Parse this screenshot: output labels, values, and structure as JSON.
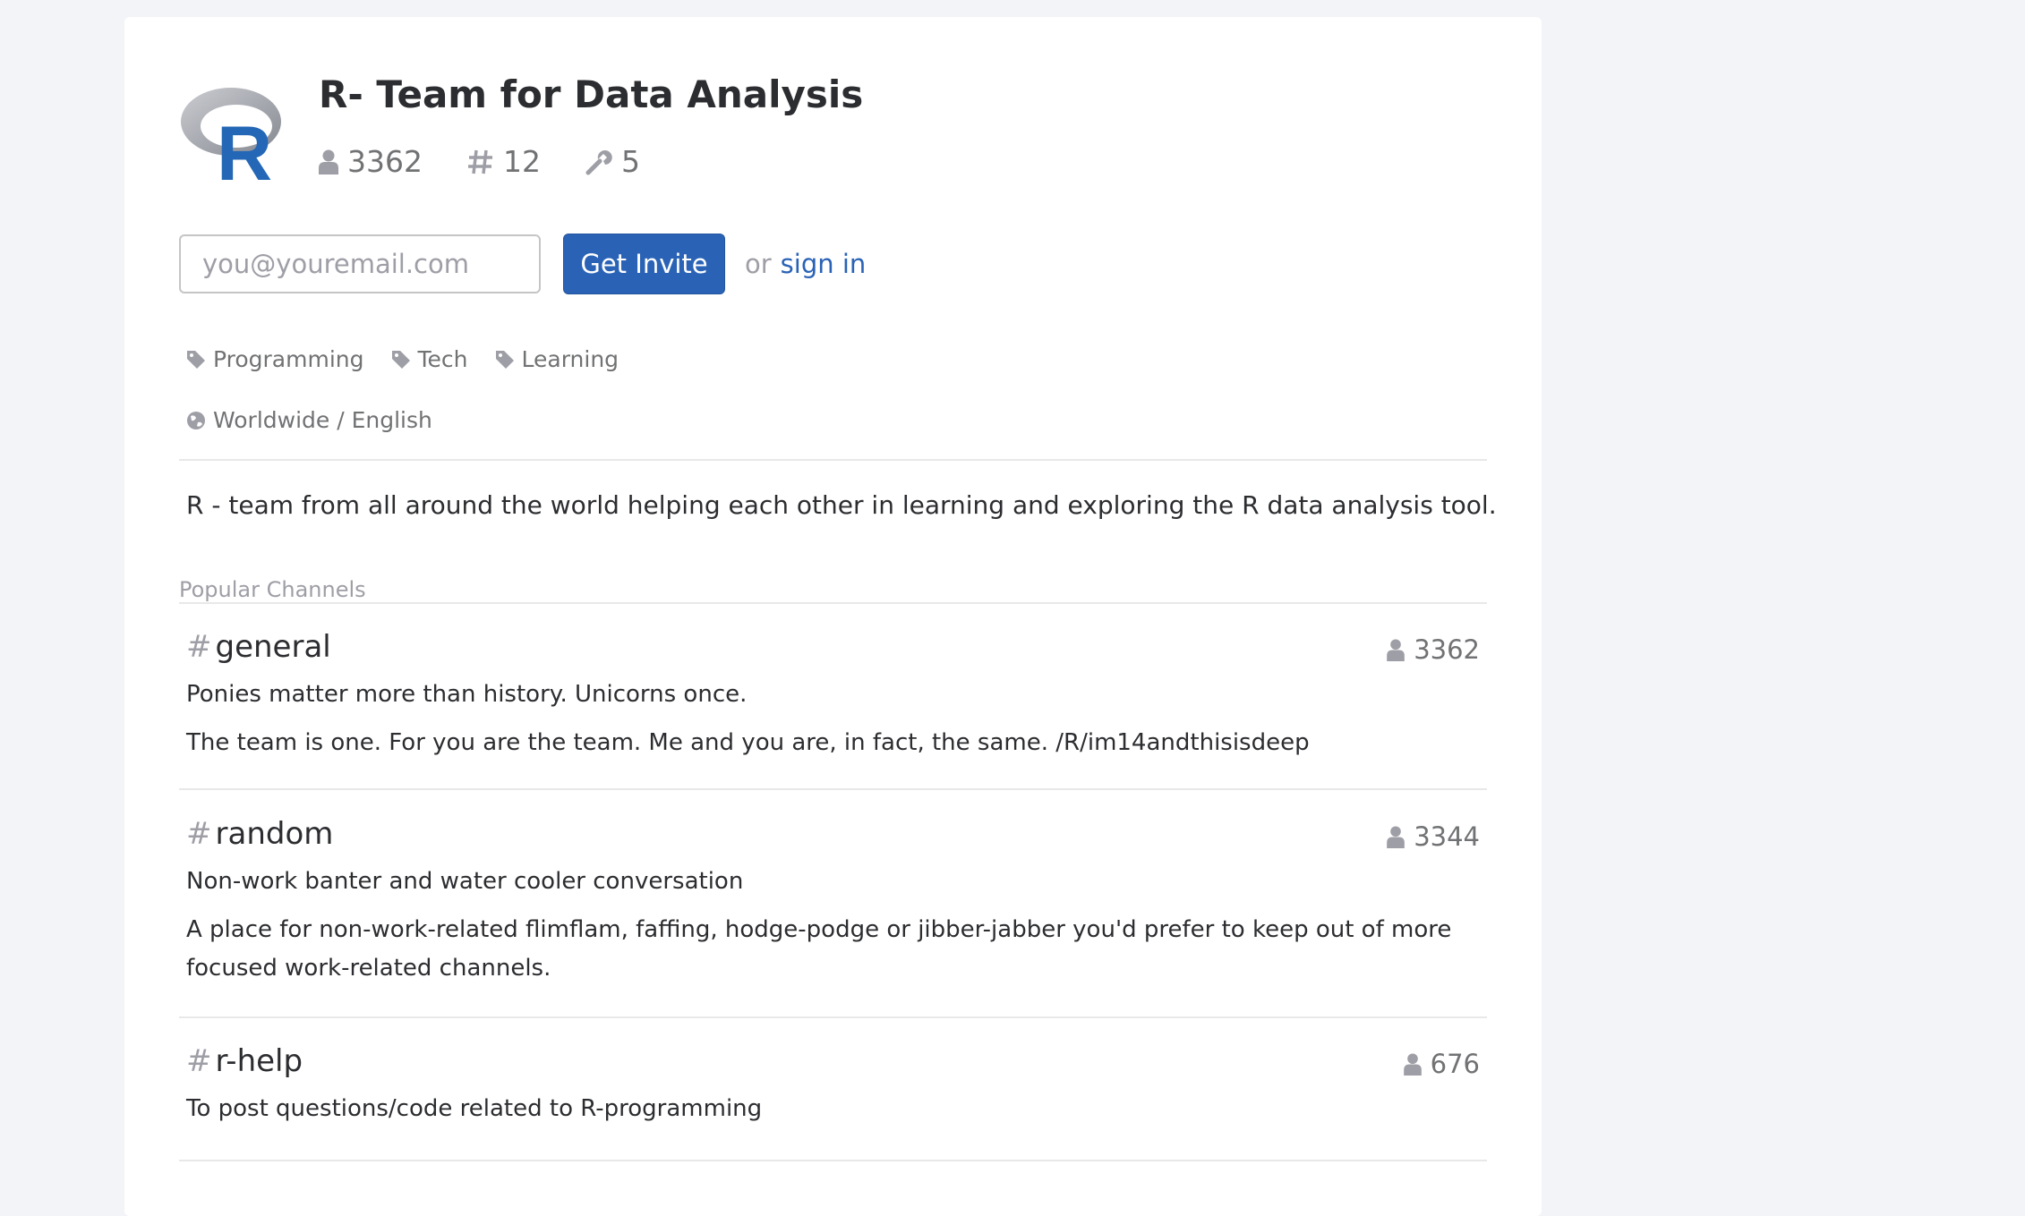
{
  "team": {
    "name": "R- Team for Data Analysis",
    "members": "3362",
    "channels": "12",
    "integrations": "5",
    "logo_letter": "R"
  },
  "invite": {
    "email_placeholder": "you@youremail.com",
    "button_label": "Get Invite",
    "or_text": "or",
    "signin_label": "sign in"
  },
  "tags": [
    "Programming",
    "Tech",
    "Learning"
  ],
  "locale": "Worldwide / English",
  "description": "R - team from all around the world helping each other in learning and exploring the R data analysis tool.",
  "popular_channels": {
    "label": "Popular Channels",
    "items": [
      {
        "name": "general",
        "members": "3362",
        "purpose": "Ponies matter more than history. Unicorns once.",
        "topic": "The team is one. For you are the team. Me and you are, in fact, the same. /R/im14andthisisdeep"
      },
      {
        "name": "random",
        "members": "3344",
        "purpose": "Non-work banter and water cooler conversation",
        "topic": "A place for non-work-related flimflam, faffing, hodge-podge or jibber-jabber you'd prefer to keep out of more focused work-related channels."
      },
      {
        "name": "r-help",
        "members": "676",
        "purpose": "To post questions/code related to R-programming",
        "topic": ""
      }
    ]
  },
  "colors": {
    "accent": "#2a63b6",
    "muted": "#9e9ea6",
    "background": "#f3f4f7"
  }
}
